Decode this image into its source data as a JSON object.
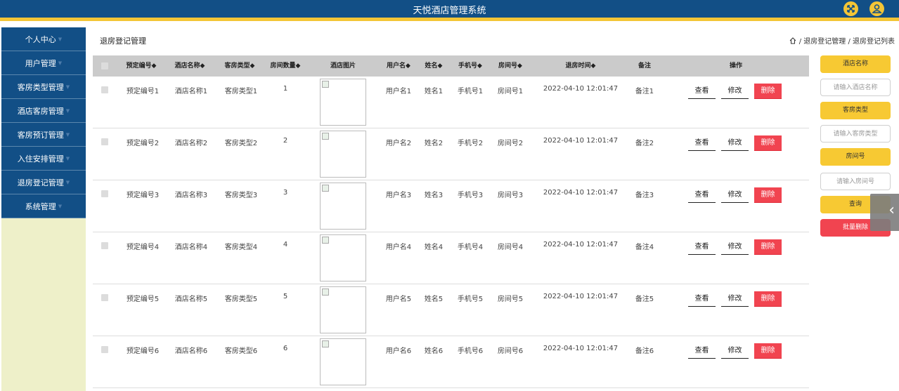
{
  "header": {
    "title": "天悦酒店管理系统",
    "fullscreen_icon": "fullscreen-icon",
    "user_icon": "user-icon",
    "accent": "#f3c536",
    "brand": "#124f86"
  },
  "sidebar": {
    "items": [
      {
        "label": "个人中心"
      },
      {
        "label": "用户管理"
      },
      {
        "label": "客房类型管理"
      },
      {
        "label": "酒店客房管理"
      },
      {
        "label": "客房预订管理"
      },
      {
        "label": "入住安排管理"
      },
      {
        "label": "退房登记管理"
      },
      {
        "label": "系统管理"
      }
    ]
  },
  "page": {
    "title": "退房登记管理",
    "breadcrumb": "/ 退房登记管理 / 退房登记列表"
  },
  "table": {
    "headers": {
      "booking_no": "预定编号",
      "hotel_name": "酒店名称",
      "room_type": "客房类型",
      "room_count": "房间数量",
      "hotel_image": "酒店图片",
      "username": "用户名",
      "name": "姓名",
      "phone": "手机号",
      "room_no": "房间号",
      "checkout_time": "退房时间",
      "note": "备注",
      "actions": "操作"
    },
    "sort_mark": "◆",
    "actions": {
      "view": "查看",
      "edit": "修改",
      "delete": "删除"
    },
    "rows": [
      {
        "booking_no": "预定编号1",
        "hotel_name": "酒店名称1",
        "room_type": "客房类型1",
        "room_count": "1",
        "username": "用户名1",
        "name": "姓名1",
        "phone": "手机号1",
        "room_no": "房间号1",
        "checkout_time": "2022-04-10 12:01:47",
        "note": "备注1"
      },
      {
        "booking_no": "预定编号2",
        "hotel_name": "酒店名称2",
        "room_type": "客房类型2",
        "room_count": "2",
        "username": "用户名2",
        "name": "姓名2",
        "phone": "手机号2",
        "room_no": "房间号2",
        "checkout_time": "2022-04-10 12:01:47",
        "note": "备注2"
      },
      {
        "booking_no": "预定编号3",
        "hotel_name": "酒店名称3",
        "room_type": "客房类型3",
        "room_count": "3",
        "username": "用户名3",
        "name": "姓名3",
        "phone": "手机号3",
        "room_no": "房间号3",
        "checkout_time": "2022-04-10 12:01:47",
        "note": "备注3"
      },
      {
        "booking_no": "预定编号4",
        "hotel_name": "酒店名称4",
        "room_type": "客房类型4",
        "room_count": "4",
        "username": "用户名4",
        "name": "姓名4",
        "phone": "手机号4",
        "room_no": "房间号4",
        "checkout_time": "2022-04-10 12:01:47",
        "note": "备注4"
      },
      {
        "booking_no": "预定编号5",
        "hotel_name": "酒店名称5",
        "room_type": "客房类型5",
        "room_count": "5",
        "username": "用户名5",
        "name": "姓名5",
        "phone": "手机号5",
        "room_no": "房间号5",
        "checkout_time": "2022-04-10 12:01:47",
        "note": "备注5"
      },
      {
        "booking_no": "预定编号6",
        "hotel_name": "酒店名称6",
        "room_type": "客房类型6",
        "room_count": "6",
        "username": "用户名6",
        "name": "姓名6",
        "phone": "手机号6",
        "room_no": "房间号6",
        "checkout_time": "2022-04-10 12:01:47",
        "note": "备注6"
      }
    ]
  },
  "search": {
    "hotel_label": "酒店名称",
    "hotel_placeholder": "请输入酒店名称",
    "type_label": "客房类型",
    "type_placeholder": "请输入客房类型",
    "room_label": "房间号",
    "room_placeholder": "请输入房间号",
    "query_button": "查询",
    "batch_delete_button": "批量删除"
  }
}
